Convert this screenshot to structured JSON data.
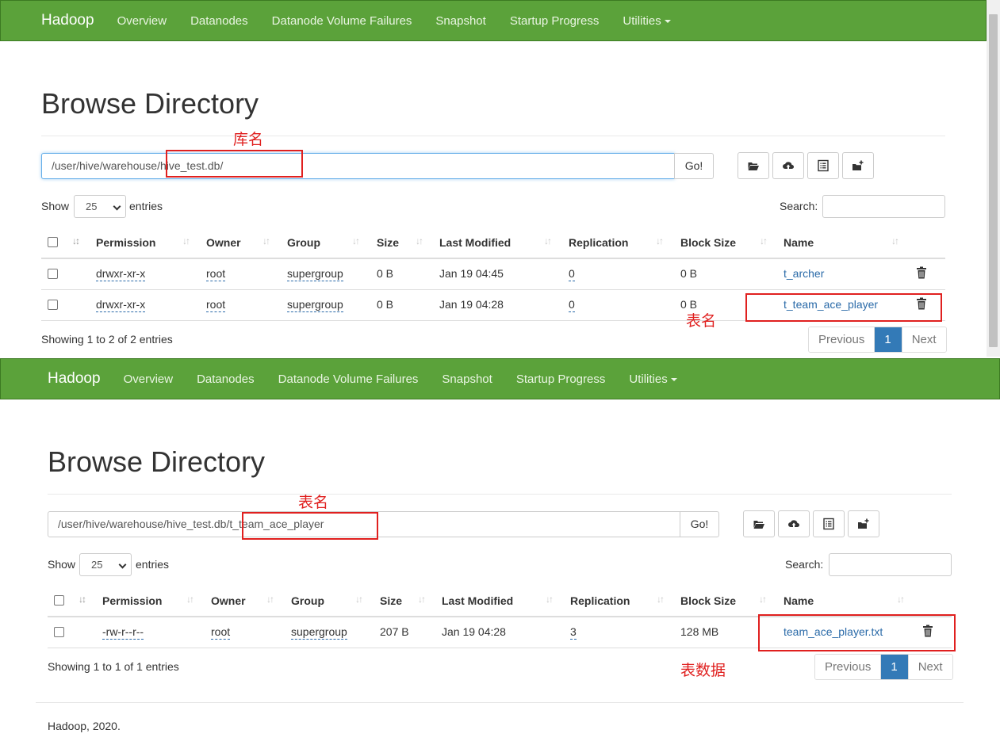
{
  "navbar": {
    "brand": "Hadoop",
    "items": [
      "Overview",
      "Datanodes",
      "Datanode Volume Failures",
      "Snapshot",
      "Startup Progress",
      "Utilities"
    ]
  },
  "top": {
    "title": "Browse Directory",
    "path": "/user/hive/warehouse/hive_test.db/",
    "go": "Go!",
    "show": "Show",
    "page_size": "25",
    "entries": "entries",
    "search": "Search:",
    "columns": [
      "Permission",
      "Owner",
      "Group",
      "Size",
      "Last Modified",
      "Replication",
      "Block Size",
      "Name"
    ],
    "rows": [
      {
        "permission": "drwxr-xr-x",
        "owner": "root",
        "group": "supergroup",
        "size": "0 B",
        "modified": "Jan 19 04:45",
        "replication": "0",
        "block_size": "0 B",
        "name": "t_archer"
      },
      {
        "permission": "drwxr-xr-x",
        "owner": "root",
        "group": "supergroup",
        "size": "0 B",
        "modified": "Jan 19 04:28",
        "replication": "0",
        "block_size": "0 B",
        "name": "t_team_ace_player"
      }
    ],
    "info": "Showing 1 to 2 of 2 entries",
    "pager": {
      "prev": "Previous",
      "page": "1",
      "next": "Next"
    },
    "annot_db": "库名",
    "annot_table": "表名"
  },
  "bottom": {
    "title": "Browse Directory",
    "path": "/user/hive/warehouse/hive_test.db/t_team_ace_player",
    "go": "Go!",
    "show": "Show",
    "page_size": "25",
    "entries": "entries",
    "search": "Search:",
    "columns": [
      "Permission",
      "Owner",
      "Group",
      "Size",
      "Last Modified",
      "Replication",
      "Block Size",
      "Name"
    ],
    "rows": [
      {
        "permission": "-rw-r--r--",
        "owner": "root",
        "group": "supergroup",
        "size": "207 B",
        "modified": "Jan 19 04:28",
        "replication": "3",
        "block_size": "128 MB",
        "name": "team_ace_player.txt"
      }
    ],
    "info": "Showing 1 to 1 of 1 entries",
    "pager": {
      "prev": "Previous",
      "page": "1",
      "next": "Next"
    },
    "annot_table": "表名",
    "annot_data": "表数据",
    "footer": "Hadoop, 2020."
  },
  "icons": [
    "folder-open-icon",
    "cloud-upload-icon",
    "list-icon",
    "folder-plus-icon",
    "trash-icon",
    "sort-icon",
    "checkbox-icon"
  ],
  "colors": {
    "navbar": "#5ba23a",
    "link": "#2a6aa8",
    "pager_active": "#337ab7",
    "annotation": "#e0201f"
  }
}
